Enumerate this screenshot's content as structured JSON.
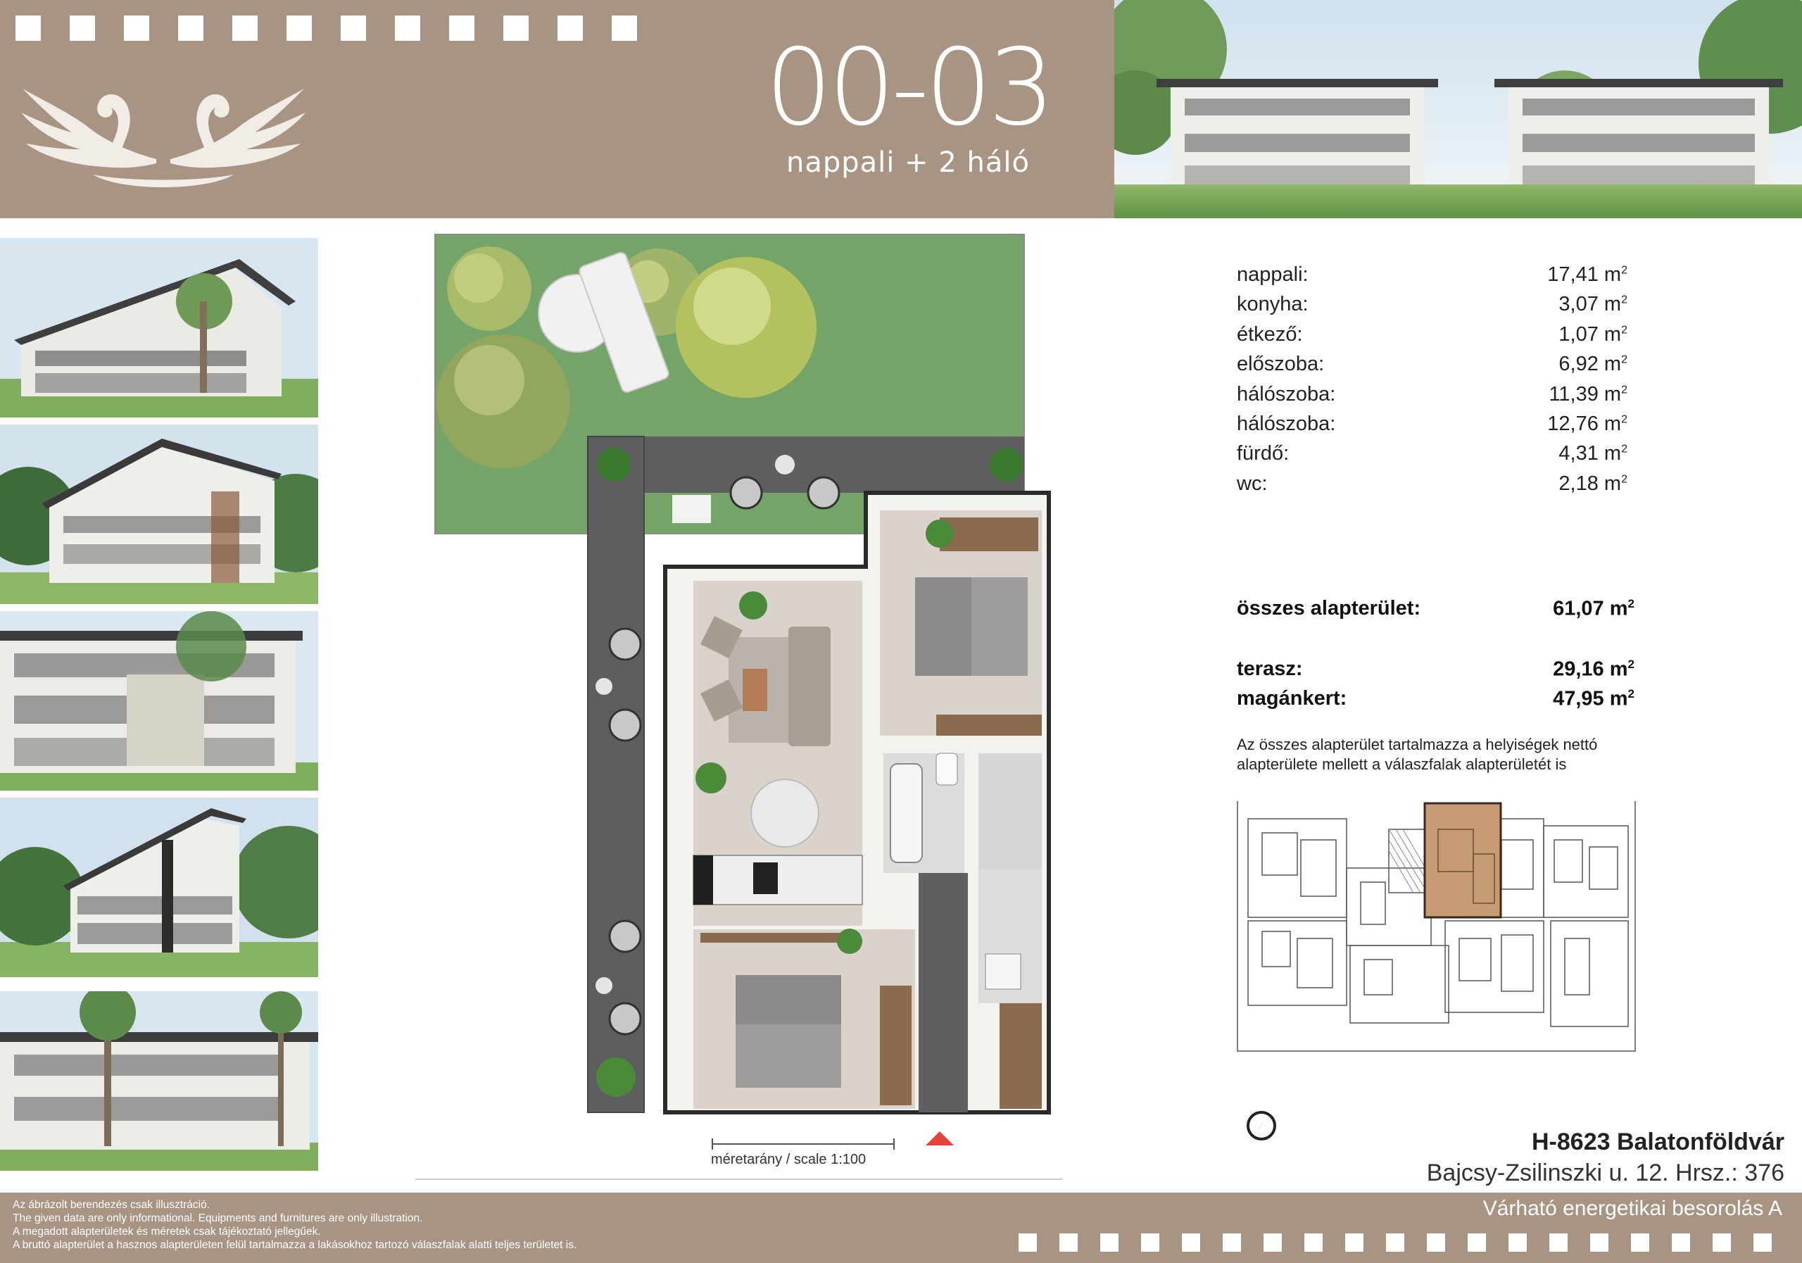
{
  "header": {
    "unit_code": "00-03",
    "unit_type": "nappali + 2 háló"
  },
  "rooms": [
    {
      "name": "nappali:",
      "area": "17,41 m",
      "unit_sup": "2"
    },
    {
      "name": "konyha:",
      "area": "3,07 m",
      "unit_sup": "2"
    },
    {
      "name": "étkező:",
      "area": "1,07 m",
      "unit_sup": "2"
    },
    {
      "name": "előszoba:",
      "area": "6,92 m",
      "unit_sup": "2"
    },
    {
      "name": "hálószoba:",
      "area": "11,39 m",
      "unit_sup": "2"
    },
    {
      "name": "hálószoba:",
      "area": "12,76 m",
      "unit_sup": "2"
    },
    {
      "name": "fürdő:",
      "area": "4,31 m",
      "unit_sup": "2"
    },
    {
      "name": "wc:",
      "area": "2,18 m",
      "unit_sup": "2"
    }
  ],
  "totals": {
    "total_label": "összes alapterület:",
    "total_value": "61,07 m",
    "terrace_label": "terasz:",
    "terrace_value": "29,16 m",
    "garden_label": "magánkert:",
    "garden_value": "47,95 m",
    "unit_sup": "2"
  },
  "note": "Az összes alapterület tartalmazza a helyiségek nettó alapterülete mellett a válaszfalak alapterületét is",
  "scale_label": "méretarány / scale 1:100",
  "address": {
    "line1": "H-8623 Balatonföldvár",
    "line2": "Bajcsy-Zsilinszki u. 12. Hrsz.: 376"
  },
  "energy_rating": "Várható energetikai besorolás A",
  "disclaimer": [
    "Az ábrázolt berendezés csak illusztráció.",
    "The given data are only informational. Equipments and furnitures are only illustration.",
    "A megadott alapterületek és méretek csak tájékoztató jellegűek.",
    "A bruttó alapterület a hasznos alapterületen felül tartalmazza a lakásokhoz tartozó válaszfalak alatti teljes területet is."
  ],
  "icons": [
    "swan-logo-icon",
    "compass-north-icon",
    "entrance-arrow-icon"
  ],
  "colors": {
    "band": "#a89482",
    "highlight": "#c69a73",
    "terrace": "#5e5e60",
    "garden": "#74a468",
    "floor": "#d9d3cb"
  }
}
